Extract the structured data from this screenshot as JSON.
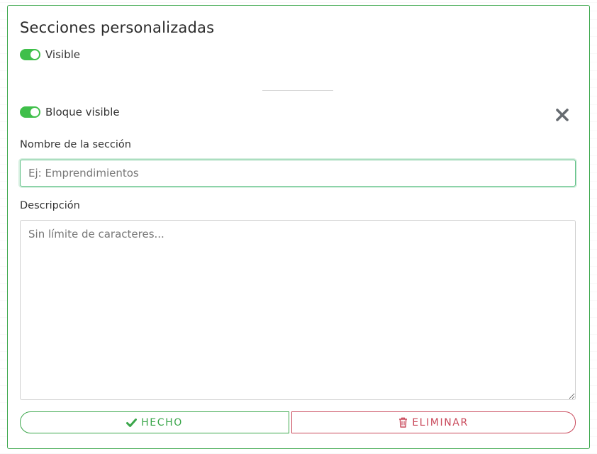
{
  "section": {
    "title": "Secciones personalizadas",
    "visible_label": "Visible",
    "visible_on": true
  },
  "block": {
    "visible_label": "Bloque visible",
    "visible_on": true,
    "close_icon": "close-icon"
  },
  "form": {
    "name_label": "Nombre de la sección",
    "name_value": "",
    "name_placeholder": "Ej: Emprendimientos",
    "description_label": "Descripción",
    "description_value": "",
    "description_placeholder": "Sin límite de caracteres..."
  },
  "actions": {
    "done_label": "HECHO",
    "done_icon": "check-icon",
    "delete_label": "ELIMINAR",
    "delete_icon": "trash-icon"
  },
  "colors": {
    "accent_green": "#3aa64a",
    "toggle_on": "#3fbf4a",
    "danger_red": "#c9485a"
  }
}
